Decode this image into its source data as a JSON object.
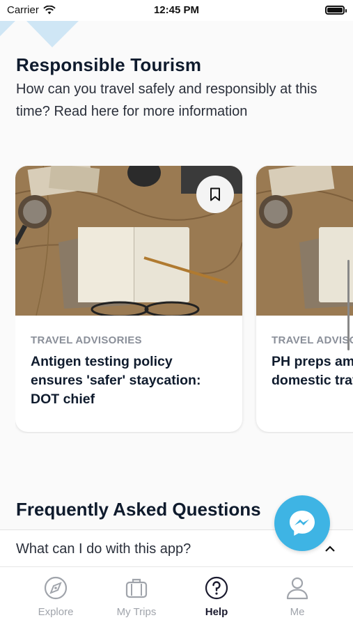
{
  "status_bar": {
    "carrier": "Carrier",
    "time": "12:45 PM"
  },
  "colors": {
    "accent": "#3eb4e4",
    "deco": "#cfe6f5",
    "title": "#0f1b2d",
    "muted": "#8a8f99"
  },
  "responsible": {
    "title": "Responsible Tourism",
    "description": "How can you travel safely and responsibly at this time? Read here for more information"
  },
  "cards": [
    {
      "category": "TRAVEL ADVISORIES",
      "title": "Antigen testing policy\nensures 'safer' staycation:\nDOT chief",
      "icon": "bookmark-icon"
    },
    {
      "category": "TRAVEL ADVISORIES",
      "title": "PH preps amid\ndomestic travel"
    }
  ],
  "faq": {
    "title": "Frequently Asked Questions",
    "items": [
      {
        "question": "What can I do with this app?"
      }
    ]
  },
  "fab": {
    "icon": "messenger-icon"
  },
  "tabs": [
    {
      "label": "Explore",
      "icon": "compass-icon",
      "active": false
    },
    {
      "label": "My Trips",
      "icon": "suitcase-icon",
      "active": false
    },
    {
      "label": "Help",
      "icon": "help-circle-icon",
      "active": true
    },
    {
      "label": "Me",
      "icon": "person-icon",
      "active": false
    }
  ]
}
